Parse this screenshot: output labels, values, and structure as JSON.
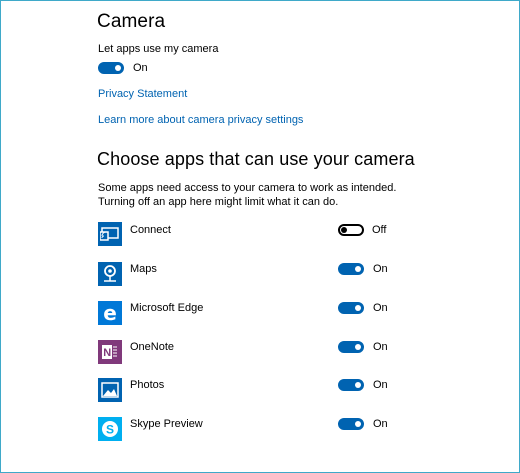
{
  "camera": {
    "title": "Camera",
    "let_apps_label": "Let apps use my camera",
    "master_toggle_label": "On",
    "privacy_link": "Privacy Statement",
    "learn_more_link": "Learn more about camera privacy settings"
  },
  "choose": {
    "title": "Choose apps that can use your camera",
    "desc_line1": "Some apps need access to your camera to work as intended.",
    "desc_line2": "Turning off an app here might limit what it can do."
  },
  "apps": [
    {
      "name": "Connect",
      "state": "Off",
      "on": false,
      "icon": "connect-icon"
    },
    {
      "name": "Maps",
      "state": "On",
      "on": true,
      "icon": "maps-icon"
    },
    {
      "name": "Microsoft Edge",
      "state": "On",
      "on": true,
      "icon": "edge-icon"
    },
    {
      "name": "OneNote",
      "state": "On",
      "on": true,
      "icon": "onenote-icon"
    },
    {
      "name": "Photos",
      "state": "On",
      "on": true,
      "icon": "photos-icon"
    },
    {
      "name": "Skype Preview",
      "state": "On",
      "on": true,
      "icon": "skype-icon"
    }
  ],
  "colors": {
    "accent": "#0063b1",
    "frame": "#3fa9c9",
    "onenote": "#80397b",
    "skype": "#00aff0"
  }
}
